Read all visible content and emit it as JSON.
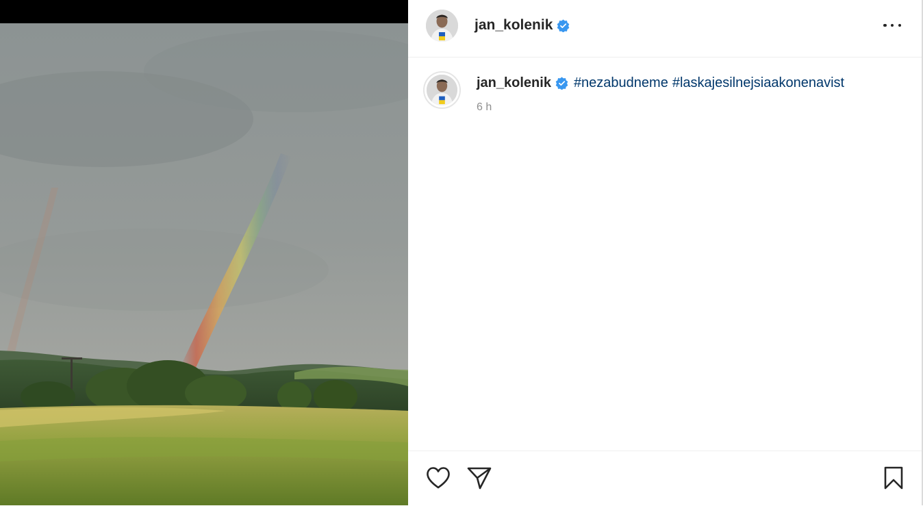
{
  "post": {
    "author": {
      "username": "jan_kolenik",
      "verified": true
    },
    "caption": {
      "hashtags": [
        "#nezabudneme",
        "#laskajesilnejsiaakonenavist"
      ],
      "time": "6 h"
    }
  },
  "icons": {
    "more": "more-horizontal-icon",
    "like": "heart-icon",
    "share": "paper-plane-icon",
    "save": "bookmark-icon",
    "verified": "verified-badge-icon"
  },
  "colors": {
    "hashtag": "#00376b",
    "verified": "#3897f0",
    "muted": "#8e8e8e",
    "text": "#262626"
  }
}
